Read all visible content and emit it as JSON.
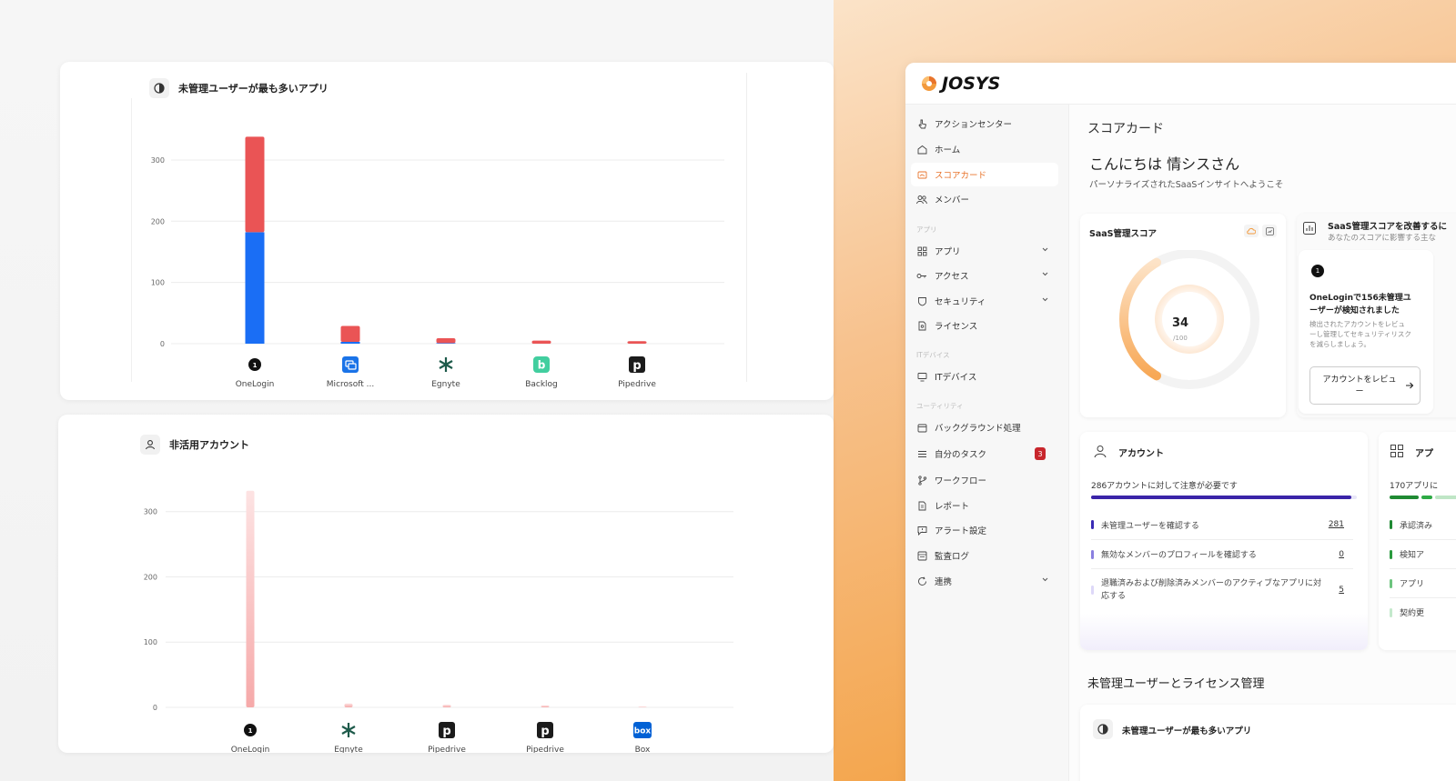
{
  "left_cards": {
    "unmanaged_chart": {
      "title": "未管理ユーザーが最も多いアプリ",
      "icon": "contrast-icon"
    },
    "inactive_chart": {
      "title": "非活用アカウント",
      "icon": "user-icon"
    }
  },
  "chart_data": [
    {
      "type": "bar",
      "title": "未管理ユーザーが最も多いアプリ",
      "categories": [
        "OneLogin",
        "Microsoft ...",
        "Egnyte",
        "Backlog",
        "Pipedrive"
      ],
      "series": [
        {
          "values": [
            182,
            3,
            1,
            0,
            0
          ]
        },
        {
          "values": [
            156,
            26,
            8,
            5,
            4
          ]
        }
      ],
      "stacked": true,
      "yticks": [
        0,
        100,
        200,
        300
      ],
      "ylim": [
        0,
        340
      ],
      "colors": [
        "#1a6ef5",
        "#ea5455"
      ],
      "grid": true
    },
    {
      "type": "bar",
      "title": "非活用アカウント",
      "categories": [
        "OneLogin",
        "Egnyte",
        "Pipedrive",
        "Pipedrive",
        "Box"
      ],
      "values": [
        332,
        6,
        4,
        3,
        1
      ],
      "yticks": [
        0,
        100,
        200,
        300
      ],
      "ylim": [
        0,
        340
      ],
      "colors": [
        "#f6b2b2"
      ],
      "grid": true
    }
  ],
  "app": {
    "logo_text": "JOSYS",
    "sidebar": {
      "items": [
        {
          "label": "アクションセンター",
          "icon": "pointer-icon"
        },
        {
          "label": "ホーム",
          "icon": "home-icon"
        },
        {
          "label": "スコアカード",
          "icon": "scorecard-icon",
          "active": true
        },
        {
          "label": "メンバー",
          "icon": "members-icon"
        }
      ],
      "section_apps": "アプリ",
      "app_items": [
        {
          "label": "アプリ",
          "icon": "grid-icon"
        },
        {
          "label": "アクセス",
          "icon": "key-icon"
        },
        {
          "label": "セキュリティ",
          "icon": "shield-icon"
        },
        {
          "label": "ライセンス",
          "icon": "license-icon"
        }
      ],
      "section_devices": "ITデバイス",
      "device_items": [
        {
          "label": "ITデバイス",
          "icon": "monitor-icon"
        }
      ],
      "section_utility": "ユーティリティ",
      "utility_items": [
        {
          "label": "バックグラウンド処理",
          "icon": "calendar-icon"
        },
        {
          "label": "自分のタスク",
          "icon": "list-icon",
          "badge": "3"
        },
        {
          "label": "ワークフロー",
          "icon": "branch-icon"
        },
        {
          "label": "レポート",
          "icon": "report-icon"
        },
        {
          "label": "アラート設定",
          "icon": "alert-icon"
        },
        {
          "label": "監査ログ",
          "icon": "audit-icon"
        },
        {
          "label": "連携",
          "icon": "sync-icon"
        }
      ]
    },
    "main": {
      "page_title": "スコアカード",
      "greeting": "こんにちは 情シスさん",
      "greeting_sub": "パーソナライズされたSaaSインサイトへようこそ",
      "score_card": {
        "title": "SaaS管理スコア",
        "score": "34",
        "score_of": "/100",
        "score_fraction": 0.34
      },
      "improve": {
        "title": "SaaS管理スコアを改善するに",
        "subtitle": "あなたのスコアに影響する主な",
        "step": "1",
        "item_title": "OneLoginで156未管理ユーザーが検知されました",
        "item_desc": "検出されたアカウントをレビューし管理してセキュリティリスクを減らしましょう。",
        "button": "アカウントをレビュー"
      },
      "accounts": {
        "title": "アカウント",
        "summary": "286アカウントに対して注意が必要です",
        "rows": [
          {
            "label": "未管理ユーザーを確認する",
            "value": "281",
            "color": "#3a2bb5"
          },
          {
            "label": "無効なメンバーのプロフィールを確認する",
            "value": "0",
            "color": "#8a7fe0"
          },
          {
            "label": "退職済みおよび削除済みメンバーのアクティブなアプリに対応する",
            "value": "5",
            "color": "#ddd8f8"
          }
        ],
        "progress": 0.98
      },
      "apps_panel": {
        "title": "アプ",
        "summary": "170アプリに",
        "rows": [
          "承認済み",
          "検知ア",
          "アプリ",
          "契約更"
        ]
      },
      "section_unmanaged": "未管理ユーザーとライセンス管理",
      "bottom_card_title": "未管理ユーザーが最も多いアプリ"
    }
  }
}
